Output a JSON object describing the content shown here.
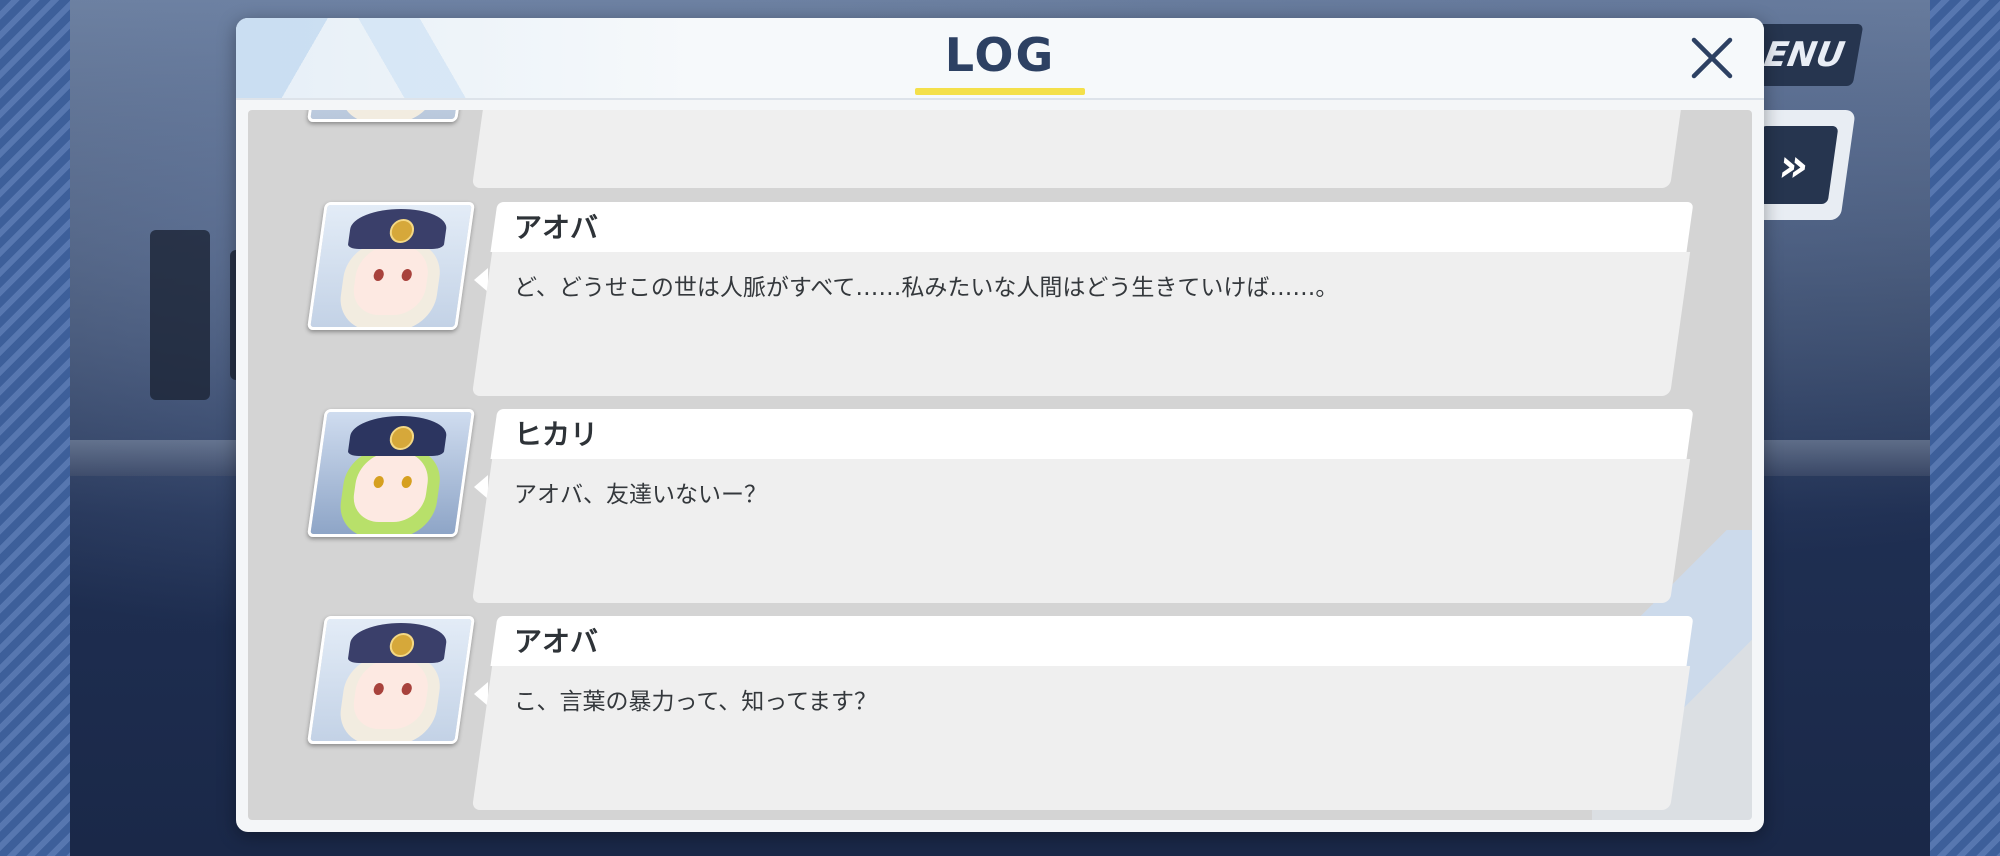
{
  "modal": {
    "title": "LOG",
    "close_icon": "close-icon"
  },
  "background": {
    "menu_label": "ENU",
    "skip_icon": "fast-forward-icon",
    "skip_label": "»"
  },
  "log_entries": [
    {
      "speaker": "",
      "text": "",
      "avatar": "aoba"
    },
    {
      "speaker": "アオバ",
      "text": "ど、どうせこの世は人脈がすべて……私みたいな人間はどう生きていけば……。",
      "avatar": "aoba"
    },
    {
      "speaker": "ヒカリ",
      "text": "アオバ、友達いないー？",
      "avatar": "hikari"
    },
    {
      "speaker": "アオバ",
      "text": "こ、言葉の暴力って、知ってます？",
      "avatar": "aoba"
    }
  ],
  "colors": {
    "title": "#2d4163",
    "underline": "#f4e04a",
    "panel": "#d4d4d4",
    "text_box": "#efefef",
    "aoba_hair": "#f2ece0",
    "hikari_hair": "#b8e06a"
  }
}
